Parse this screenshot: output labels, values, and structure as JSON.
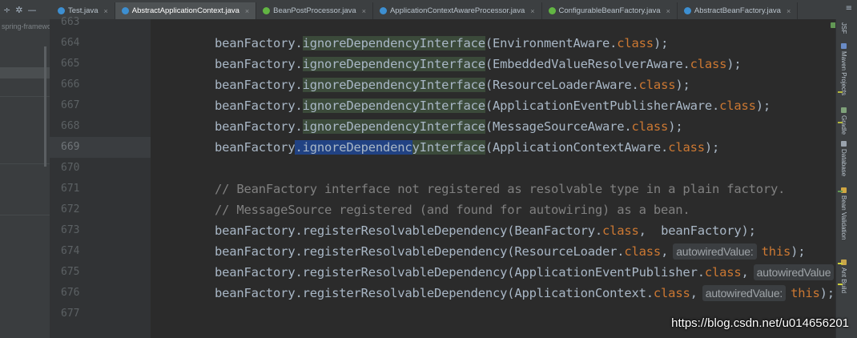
{
  "tabbar": {
    "tools": [
      "÷",
      "✲",
      "—"
    ],
    "tabs": [
      {
        "label": "Test.java",
        "active": false,
        "color": "#3d8fd1"
      },
      {
        "label": "AbstractApplicationContext.java",
        "active": true,
        "color": "#3d8fd1"
      },
      {
        "label": "BeanPostProcessor.java",
        "active": false,
        "color": "#62b543"
      },
      {
        "label": "ApplicationContextAwareProcessor.java",
        "active": false,
        "color": "#3d8fd1"
      },
      {
        "label": "ConfigurableBeanFactory.java",
        "active": false,
        "color": "#62b543"
      },
      {
        "label": "AbstractBeanFactory.java",
        "active": false,
        "color": "#3d8fd1"
      }
    ],
    "overflow": "≡"
  },
  "project_panel": {
    "label": "spring-framewo"
  },
  "gutter": {
    "lines": [
      "663",
      "664",
      "665",
      "666",
      "667",
      "668",
      "669",
      "670",
      "671",
      "672",
      "673",
      "674",
      "675",
      "676",
      "677"
    ],
    "current_index": 6
  },
  "code": {
    "lines": [
      {
        "tokens": [
          {
            "t": "beanFactory."
          },
          {
            "t": "ignoreDependencyInterface",
            "cls": "m"
          },
          {
            "t": "(EnvironmentAware."
          },
          {
            "t": "class",
            "cls": "k"
          },
          {
            "t": ");"
          }
        ]
      },
      {
        "tokens": [
          {
            "t": "beanFactory."
          },
          {
            "t": "ignoreDependencyInterface",
            "cls": "m"
          },
          {
            "t": "(EmbeddedValueResolverAware."
          },
          {
            "t": "class",
            "cls": "k"
          },
          {
            "t": ");"
          }
        ]
      },
      {
        "tokens": [
          {
            "t": "beanFactory."
          },
          {
            "t": "ignoreDependencyInterface",
            "cls": "m"
          },
          {
            "t": "(ResourceLoaderAware."
          },
          {
            "t": "class",
            "cls": "k"
          },
          {
            "t": ");"
          }
        ]
      },
      {
        "tokens": [
          {
            "t": "beanFactory."
          },
          {
            "t": "ignoreDependencyInterface",
            "cls": "m"
          },
          {
            "t": "(ApplicationEventPublisherAware."
          },
          {
            "t": "class",
            "cls": "k"
          },
          {
            "t": ");"
          }
        ]
      },
      {
        "tokens": [
          {
            "t": "beanFactory."
          },
          {
            "t": "ignoreDependencyInterface",
            "cls": "m"
          },
          {
            "t": "(MessageSourceAware."
          },
          {
            "t": "class",
            "cls": "k"
          },
          {
            "t": ");"
          }
        ]
      },
      {
        "tokens": [
          {
            "t": "beanFactory"
          },
          {
            "t": ".ignoreDependenc",
            "cls": "m sel"
          },
          {
            "t": "yInterface",
            "cls": "m"
          },
          {
            "t": "(ApplicationContextAware."
          },
          {
            "t": "class",
            "cls": "k"
          },
          {
            "t": ");"
          }
        ]
      },
      {
        "tokens": []
      },
      {
        "tokens": [
          {
            "t": "// BeanFactory interface not registered as resolvable type in a plain factory.",
            "cls": "c"
          }
        ]
      },
      {
        "tokens": [
          {
            "t": "// MessageSource registered (and found for autowiring) as a bean.",
            "cls": "c"
          }
        ]
      },
      {
        "tokens": [
          {
            "t": "beanFactory.registerResolvableDependency(BeanFactory."
          },
          {
            "t": "class",
            "cls": "k"
          },
          {
            "t": ",  beanFactory);"
          }
        ]
      },
      {
        "tokens": [
          {
            "t": "beanFactory.registerResolvableDependency(ResourceLoader."
          },
          {
            "t": "class",
            "cls": "k"
          },
          {
            "t": ","
          },
          {
            "t": "autowiredValue:",
            "cls": "hint"
          },
          {
            "t": "this",
            "cls": "k"
          },
          {
            "t": ");"
          }
        ]
      },
      {
        "tokens": [
          {
            "t": "beanFactory.registerResolvableDependency(ApplicationEventPublisher."
          },
          {
            "t": "class",
            "cls": "k"
          },
          {
            "t": ","
          },
          {
            "t": "autowiredValue",
            "cls": "hint"
          }
        ]
      },
      {
        "tokens": [
          {
            "t": "beanFactory.registerResolvableDependency(ApplicationContext."
          },
          {
            "t": "class",
            "cls": "k"
          },
          {
            "t": ","
          },
          {
            "t": "autowiredValue:",
            "cls": "hint"
          },
          {
            "t": "this",
            "cls": "k"
          },
          {
            "t": ");"
          }
        ]
      }
    ]
  },
  "right_strip": {
    "tabs": [
      {
        "label": "Maven Projects",
        "icon_color": "#6a8cc7"
      },
      {
        "label": "Gradle",
        "icon_color": "#7fa27a"
      },
      {
        "label": "Database",
        "icon_color": "#9aa3ad"
      },
      {
        "label": "Bean Validation",
        "icon_color": "#d0a742"
      },
      {
        "label": "Ant Build",
        "icon_color": "#c9a64a"
      }
    ],
    "top_label": "JSF",
    "marker_colors": [
      "#b5b83d",
      "#b5b83d",
      "#629755",
      "#cfcf3a",
      "#cfcf3a"
    ]
  },
  "watermark": "https://blog.csdn.net/u014656201"
}
